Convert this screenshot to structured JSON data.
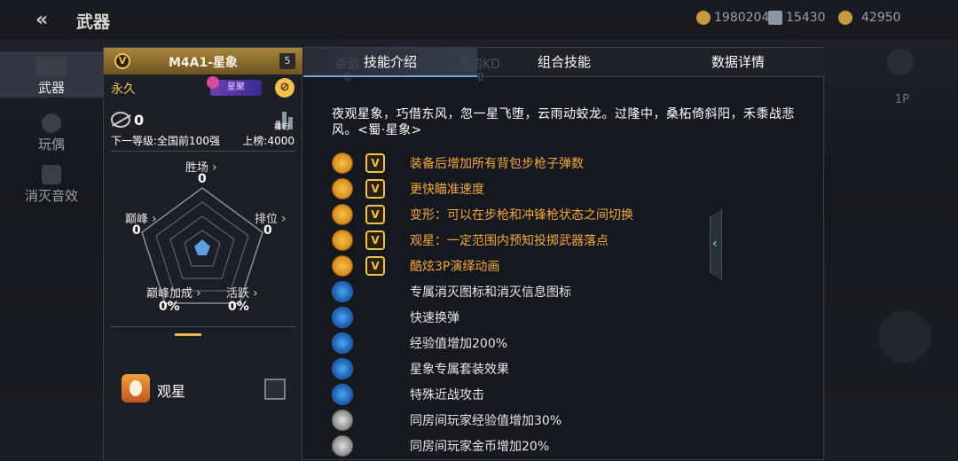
{
  "header": {
    "back_icon": "back-chevron-icon",
    "title": "武器"
  },
  "currency": [
    {
      "icon": "gold-coin-icon",
      "value": "1980204",
      "color": "#c89a3a"
    },
    {
      "icon": "wings-icon",
      "value": "15430",
      "color": "#8a96a6"
    },
    {
      "icon": "bag-icon",
      "value": "42950",
      "color": "#c89a3a"
    }
  ],
  "nav": {
    "items": [
      {
        "label": "武器",
        "icon": "rifle-icon"
      },
      {
        "label": "玩偶",
        "icon": "doll-icon"
      },
      {
        "label": "消灭音效",
        "icon": "speaker-icon"
      }
    ]
  },
  "weapon": {
    "badge": "V",
    "name": "M4A1-星象",
    "level": "5",
    "duration": "永久",
    "star_badge": "星聚",
    "kills": "0",
    "rank_icon_label": "排行",
    "next_level": "下一等级:全国前100强",
    "on_list": "上榜:4000"
  },
  "radar": {
    "stats": [
      {
        "label": "胜场",
        "value": "0"
      },
      {
        "label": "排位",
        "value": "0"
      },
      {
        "label": "活跃",
        "value": "0%"
      },
      {
        "label": "巅峰加成",
        "value": "0%"
      },
      {
        "label": "巅峰",
        "value": "0"
      }
    ]
  },
  "skin": {
    "name": "观星"
  },
  "tabs": [
    "技能介绍",
    "组合技能",
    "数据详情"
  ],
  "ghost_tabs": {
    "left_label": "杀敌",
    "left_value": "0",
    "right_label": "平均KD",
    "right_value": "0"
  },
  "flavor": "夜观星象，巧借东风，忽一星飞堕，云雨动蛟龙。过隆中，桑柘倚斜阳，禾黍战悲风。<蜀·星象>",
  "skills": [
    {
      "icon": "bullet-icon",
      "tier": "gold",
      "v": "V",
      "text": "装备后增加所有背包步枪子弹数"
    },
    {
      "icon": "crosshair-icon",
      "tier": "gold",
      "v": "V",
      "text": "更快瞄准速度"
    },
    {
      "icon": "transform-icon",
      "tier": "gold",
      "v": "V",
      "text": "变形：可以在步枪和冲锋枪状态之间切换"
    },
    {
      "icon": "eye-icon",
      "tier": "gold",
      "v": "V",
      "text": "观星：一定范围内预知投掷武器落点"
    },
    {
      "icon": "figure-icon",
      "tier": "gold",
      "v": "V",
      "text": "酷炫3P演绎动画"
    },
    {
      "icon": "kill-mark-icon",
      "tier": "blue",
      "text": "专属消灭图标和消灭信息图标"
    },
    {
      "icon": "reload-icon",
      "tier": "blue",
      "text": "快速换弹"
    },
    {
      "icon": "exp-icon",
      "tier": "blue",
      "text": "经验值增加200%"
    },
    {
      "icon": "suit-icon",
      "tier": "blue",
      "text": "星象专属套装效果"
    },
    {
      "icon": "melee-icon",
      "tier": "blue",
      "text": "特殊近战攻击"
    },
    {
      "icon": "exp-room-icon",
      "tier": "gray",
      "text": "同房间玩家经验值增加30%"
    },
    {
      "icon": "coin-room-icon",
      "tier": "gray",
      "text": "同房间玩家金币增加20%"
    }
  ],
  "colors": {
    "accent": "#f4c14a",
    "tab_active": "#6aa8e0",
    "panel_bg": "#16191f"
  }
}
